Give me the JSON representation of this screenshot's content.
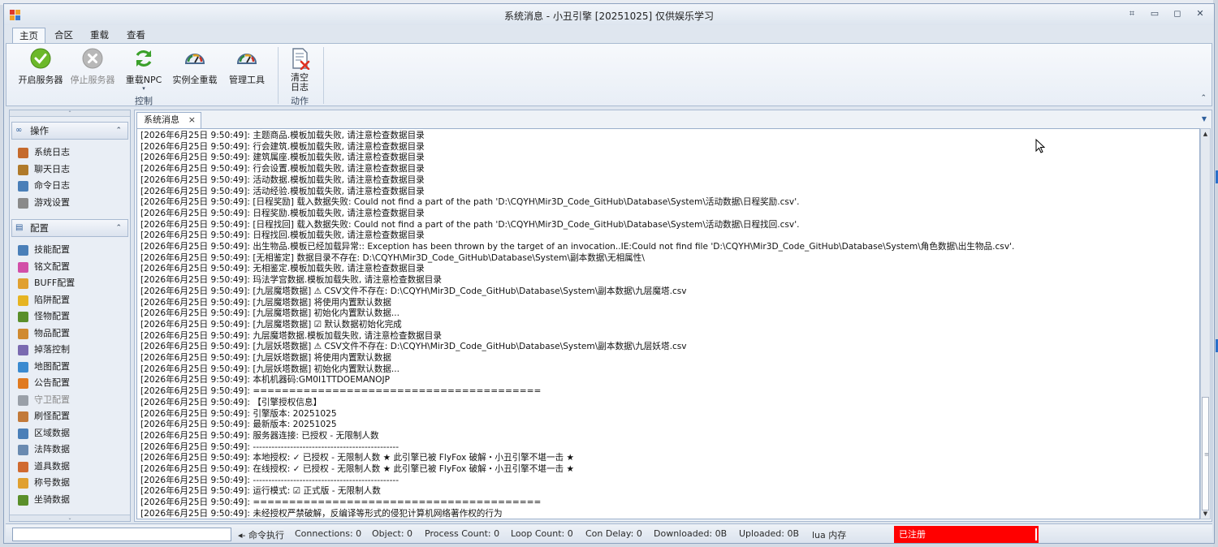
{
  "window": {
    "title": "系统消息 - 小丑引擎 [20251025] 仅供娱乐学习",
    "controls": [
      "restore",
      "minimize",
      "maximize",
      "close"
    ]
  },
  "ribbon": {
    "tabs": [
      "主页",
      "合区",
      "重载",
      "查看"
    ],
    "active_tab": "主页",
    "buttons": {
      "start_server": "开启服务器",
      "stop_server": "停止服务器",
      "reload_npc": "重载NPC",
      "reload_all": "实例全重载",
      "admin_tools": "管理工具",
      "clear_log_line1": "清空",
      "clear_log_line2": "日志"
    },
    "groups": {
      "control": "控制",
      "action": "动作"
    }
  },
  "sidebar": {
    "operations": {
      "header": "操作",
      "items": [
        {
          "label": "系统日志",
          "icon": "system-log-icon",
          "color": "#c56a2c"
        },
        {
          "label": "聊天日志",
          "icon": "chat-log-icon",
          "color": "#b07a2a"
        },
        {
          "label": "命令日志",
          "icon": "command-log-icon",
          "color": "#4a7fb8"
        },
        {
          "label": "游戏设置",
          "icon": "game-settings-icon",
          "color": "#8a8a8a"
        }
      ]
    },
    "config": {
      "header": "配置",
      "items": [
        {
          "label": "技能配置",
          "icon": "skill-config-icon",
          "color": "#4a7fb8",
          "disabled": false
        },
        {
          "label": "铭文配置",
          "icon": "inscription-config-icon",
          "color": "#d24fa8",
          "disabled": false
        },
        {
          "label": "BUFF配置",
          "icon": "buff-config-icon",
          "color": "#e0a030",
          "disabled": false
        },
        {
          "label": "陷阱配置",
          "icon": "trap-config-icon",
          "color": "#e6b422",
          "disabled": false
        },
        {
          "label": "怪物配置",
          "icon": "monster-config-icon",
          "color": "#5a8f2a",
          "disabled": false
        },
        {
          "label": "物品配置",
          "icon": "item-config-icon",
          "color": "#d08a30",
          "disabled": false
        },
        {
          "label": "掉落控制",
          "icon": "drop-control-icon",
          "color": "#7a6ab0",
          "disabled": false
        },
        {
          "label": "地图配置",
          "icon": "map-config-icon",
          "color": "#3a8ad0",
          "disabled": false
        },
        {
          "label": "公告配置",
          "icon": "announcement-config-icon",
          "color": "#e07a20",
          "disabled": false
        },
        {
          "label": "守卫配置",
          "icon": "guard-config-icon",
          "color": "#9aa0a8",
          "disabled": true
        },
        {
          "label": "刷怪配置",
          "icon": "spawn-config-icon",
          "color": "#c27a3a",
          "disabled": false
        },
        {
          "label": "区域数据",
          "icon": "region-data-icon",
          "color": "#4a7fb8",
          "disabled": false
        },
        {
          "label": "法阵数据",
          "icon": "formation-data-icon",
          "color": "#6a8ab0",
          "disabled": false
        },
        {
          "label": "道具数据",
          "icon": "prop-data-icon",
          "color": "#d06a30",
          "disabled": false
        },
        {
          "label": "称号数据",
          "icon": "title-data-icon",
          "color": "#e0a030",
          "disabled": false
        },
        {
          "label": "坐骑数据",
          "icon": "mount-data-icon",
          "color": "#5a8f2a",
          "disabled": false
        }
      ]
    }
  },
  "document": {
    "tab_label": "系统消息",
    "log_lines": [
      "[2026年6月25日 9:50:49]: 主题商品.模板加载失败, 请注意检查数据目录",
      "[2026年6月25日 9:50:49]: 行会建筑.模板加载失败, 请注意检查数据目录",
      "[2026年6月25日 9:50:49]: 建筑属座.模板加载失败, 请注意检查数据目录",
      "[2026年6月25日 9:50:49]: 行会设置.模板加载失败, 请注意检查数据目录",
      "[2026年6月25日 9:50:49]: 活动数据.模板加载失败, 请注意检查数据目录",
      "[2026年6月25日 9:50:49]: 活动经验.模板加载失败, 请注意检查数据目录",
      "[2026年6月25日 9:50:49]: [日程奖励] 载入数据失败: Could not find a part of the path 'D:\\CQYH\\Mir3D_Code_GitHub\\Database\\System\\活动数据\\日程奖励.csv'.",
      "[2026年6月25日 9:50:49]: 日程奖励.模板加载失败, 请注意检查数据目录",
      "[2026年6月25日 9:50:49]: [日程找回] 载入数据失败: Could not find a part of the path 'D:\\CQYH\\Mir3D_Code_GitHub\\Database\\System\\活动数据\\日程找回.csv'.",
      "[2026年6月25日 9:50:49]: 日程找回.模板加载失败, 请注意检查数据目录",
      "[2026年6月25日 9:50:49]: 出生物品.模板已经加载异常:: Exception has been thrown by the target of an invocation..IE:Could not find file 'D:\\CQYH\\Mir3D_Code_GitHub\\Database\\System\\角色数据\\出生物品.csv'.",
      "[2026年6月25日 9:50:49]: [无相鉴定] 数据目录不存在: D:\\CQYH\\Mir3D_Code_GitHub\\Database\\System\\副本数据\\无相属性\\",
      "[2026年6月25日 9:50:49]: 无相鉴定.模板加载失败, 请注意检查数据目录",
      "[2026年6月25日 9:50:49]: 玛法学宫数据.模板加载失败, 请注意检查数据目录",
      "[2026年6月25日 9:50:49]: [九层魔塔数据] ⚠ CSV文件不存在: D:\\CQYH\\Mir3D_Code_GitHub\\Database\\System\\副本数据\\九层魔塔.csv",
      "[2026年6月25日 9:50:49]: [九层魔塔数据] 将使用内置默认数据",
      "[2026年6月25日 9:50:49]: [九层魔塔数据] 初始化内置默认数据...",
      "[2026年6月25日 9:50:49]: [九层魔塔数据] ☑ 默认数据初始化完成",
      "[2026年6月25日 9:50:49]: 九层魔塔数据.模板加载失败, 请注意检查数据目录",
      "[2026年6月25日 9:50:49]: [九层妖塔数据] ⚠ CSV文件不存在: D:\\CQYH\\Mir3D_Code_GitHub\\Database\\System\\副本数据\\九层妖塔.csv",
      "[2026年6月25日 9:50:49]: [九层妖塔数据] 将使用内置默认数据",
      "[2026年6月25日 9:50:49]: [九层妖塔数据] 初始化内置默认数据...",
      "[2026年6月25日 9:50:49]: 本机机器码:GM0I1TTDOEMANOJP",
      "[2026年6月25日 9:50:49]: ========================================",
      "[2026年6月25日 9:50:49]: 【引擎授权信息】",
      "[2026年6月25日 9:50:49]:   引擎版本: 20251025",
      "[2026年6月25日 9:50:49]:   最新版本: 20251025",
      "[2026年6月25日 9:50:49]:   服务器连接: 已授权 - 无限制人数",
      "[2026年6月25日 9:50:49]: -----------------------------------------------",
      "[2026年6月25日 9:50:49]:   本地授权: ✓ 已授权 - 无限制人数   ★ 此引擎已被 FlyFox 破解・小丑引擎不堪一击 ★",
      "[2026年6月25日 9:50:49]:   在线授权: ✓ 已授权 - 无限制人数   ★ 此引擎已被 FlyFox 破解・小丑引擎不堪一击 ★",
      "[2026年6月25日 9:50:49]: -----------------------------------------------",
      "[2026年6月25日 9:50:49]:   运行模式: ☑ 正式版 - 无限制人数",
      "[2026年6月25日 9:50:49]: ========================================",
      "[2026年6月25日 9:50:49]: 未经授权严禁破解，反编译等形式的侵犯计算机网络著作权的行为"
    ]
  },
  "statusbar": {
    "command_input_value": "",
    "execute_label": "◂- 命令执行",
    "connections": "Connections: 0",
    "object": "Object: 0",
    "process_count": "Process Count: 0",
    "loop_count": "Loop Count: 0",
    "con_delay": "Con Delay: 0",
    "downloaded": "Downloaded: 0B",
    "uploaded": "Uploaded: 0B",
    "lua_memory": "lua 内存",
    "registration": "已注册",
    "registration_color": "#ff0000"
  },
  "colors": {
    "accent": "#2f5f9c",
    "ribbon_bg": "#e8eef6",
    "window_border": "#8da2bf"
  }
}
